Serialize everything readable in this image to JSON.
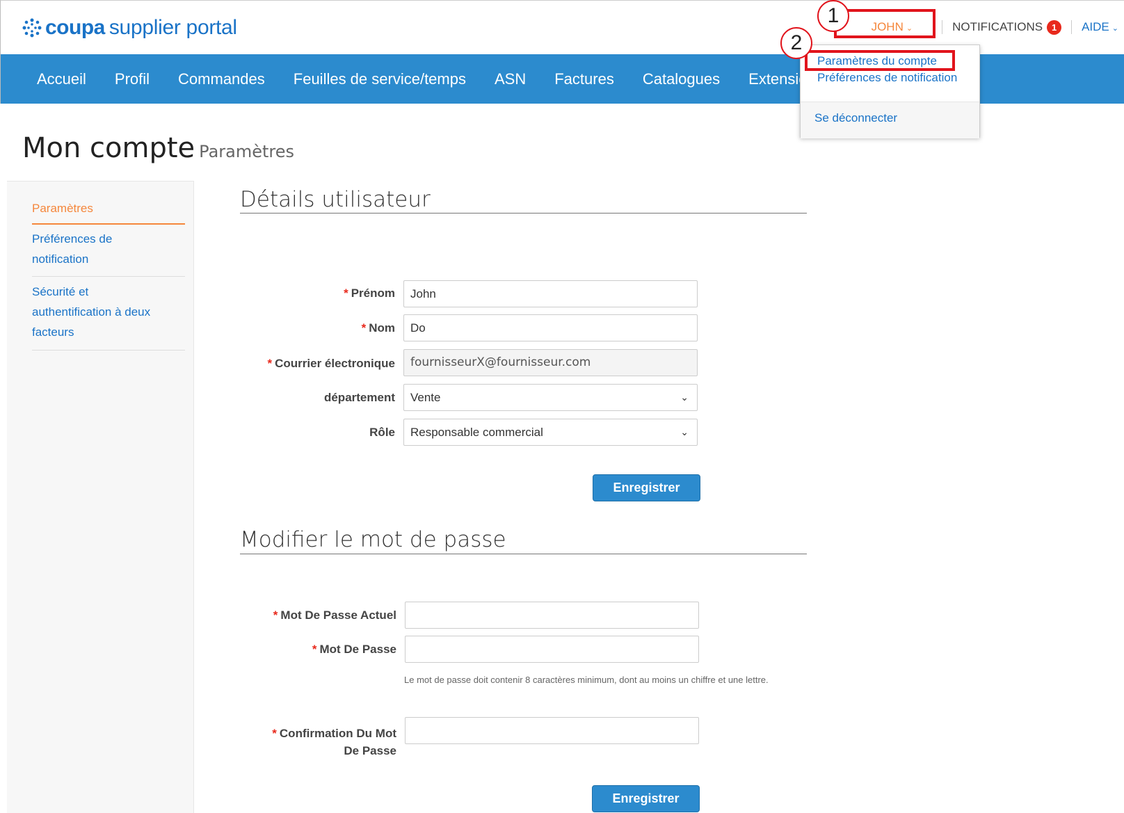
{
  "header": {
    "brand": "coupa",
    "brand_rest": "supplier portal",
    "user_label": "JOHN",
    "notifications_label": "NOTIFICATIONS",
    "notifications_count": "1",
    "help_label": "AIDE"
  },
  "nav": {
    "items": [
      "Accueil",
      "Profil",
      "Commandes",
      "Feuilles de service/temps",
      "ASN",
      "Factures",
      "Catalogues",
      "Extension"
    ]
  },
  "user_menu": {
    "account_settings": "Paramètres du compte",
    "notification_prefs": "Préférences de notification",
    "logout": "Se déconnecter"
  },
  "annotations": {
    "step1": "1",
    "step2": "2"
  },
  "page": {
    "title": "Mon compte",
    "subtitle": "Paramètres"
  },
  "sidebar": {
    "items": [
      {
        "label": "Paramètres"
      },
      {
        "label": "Préférences de notification"
      },
      {
        "label": "Sécurité et authentification à deux facteurs"
      }
    ]
  },
  "user_details": {
    "title": "Détails utilisateur",
    "first_name_label": "Prénom",
    "first_name_value": "John",
    "last_name_label": "Nom",
    "last_name_value": "Do",
    "email_label": "Courrier électronique",
    "email_value": "fournisseurX@fournisseur.com",
    "department_label": "département",
    "department_value": "Vente",
    "role_label": "Rôle",
    "role_value": "Responsable commercial",
    "save_label": "Enregistrer"
  },
  "password": {
    "title": "Modifier le mot de passe",
    "current_label": "Mot De Passe Actuel",
    "new_label": "Mot De Passe",
    "hint": "Le mot de passe doit contenir 8 caractères minimum, dont au moins un chiffre et une lettre.",
    "confirm_label_1": "Confirmation Du Mot",
    "confirm_label_2": "De Passe",
    "save_label": "Enregistrer"
  },
  "required_marker": "*",
  "colors": {
    "brand_blue": "#2c8bce",
    "link_blue": "#1a73c7",
    "accent_orange": "#f5873c",
    "annotation_red": "#e1141c"
  }
}
